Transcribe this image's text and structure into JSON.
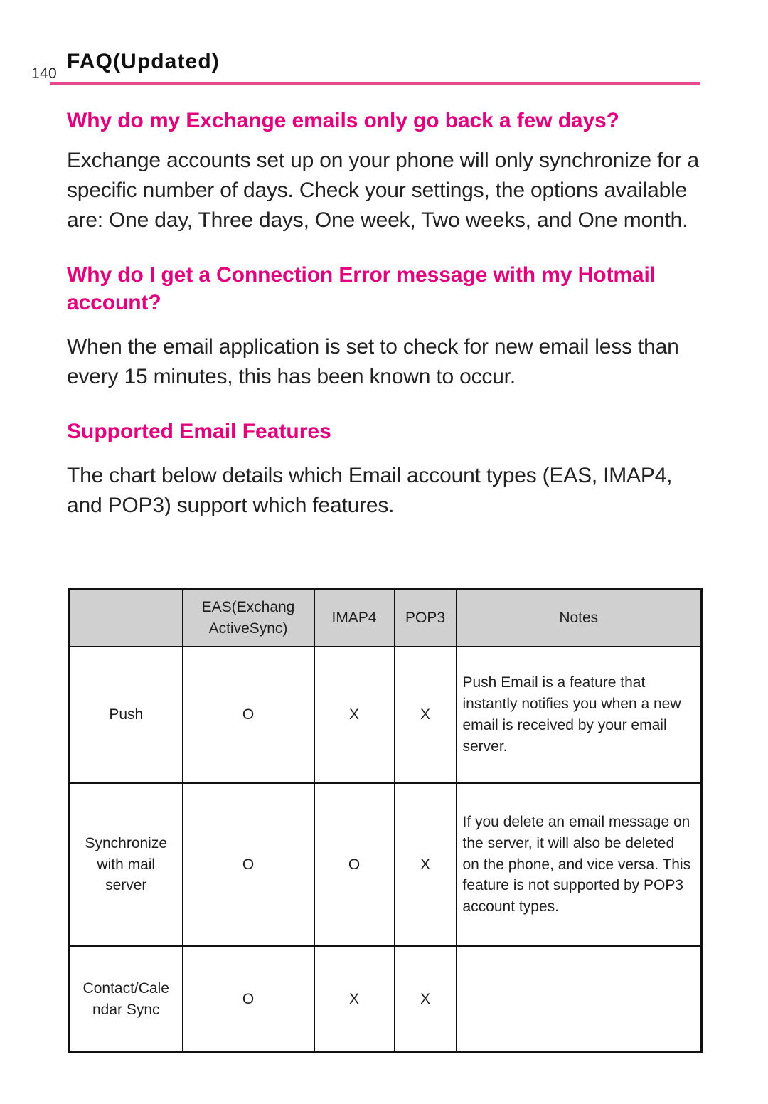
{
  "header": {
    "page_number": "140",
    "title": "FAQ(Updated)",
    "rule_color": "#e8488f"
  },
  "accent_color": "#e2007d",
  "sections": [
    {
      "heading": "Why do my Exchange emails only go back a few days?",
      "body": "Exchange accounts set up on your phone will only synchronize for a specific number of days. Check your settings, the options available are: One day, Three days, One week, Two weeks, and One month."
    },
    {
      "heading": "Why do I get a Connection Error message with my Hotmail account?",
      "body": "When the email application is set to check for new email less than every 15 minutes, this has been known to occur."
    },
    {
      "heading": "Supported Email Features",
      "body": "The chart below details which Email account types (EAS, IMAP4, and POP3) support which features."
    }
  ],
  "table": {
    "header_background": "#d0d0d0",
    "columns": [
      {
        "label": "",
        "key": "feature"
      },
      {
        "label": "EAS(Exchang ActiveSync)",
        "key": "eas"
      },
      {
        "label": "IMAP4",
        "key": "imap4"
      },
      {
        "label": "POP3",
        "key": "pop3"
      },
      {
        "label": "Notes",
        "key": "notes"
      }
    ],
    "rows": [
      {
        "feature": "Push",
        "eas": "O",
        "imap4": "X",
        "pop3": "X",
        "notes": "Push Email is a feature that instantly notifies you when a new email is received by your email server."
      },
      {
        "feature": "Synchronize with mail server",
        "eas": "O",
        "imap4": "O",
        "pop3": "X",
        "notes": "If you delete an email message on the server, it will also be deleted on the phone, and vice versa. This feature is not supported by POP3 account types."
      },
      {
        "feature": "Contact/Cale ndar Sync",
        "eas": "O",
        "imap4": "X",
        "pop3": "X",
        "notes": ""
      }
    ]
  }
}
